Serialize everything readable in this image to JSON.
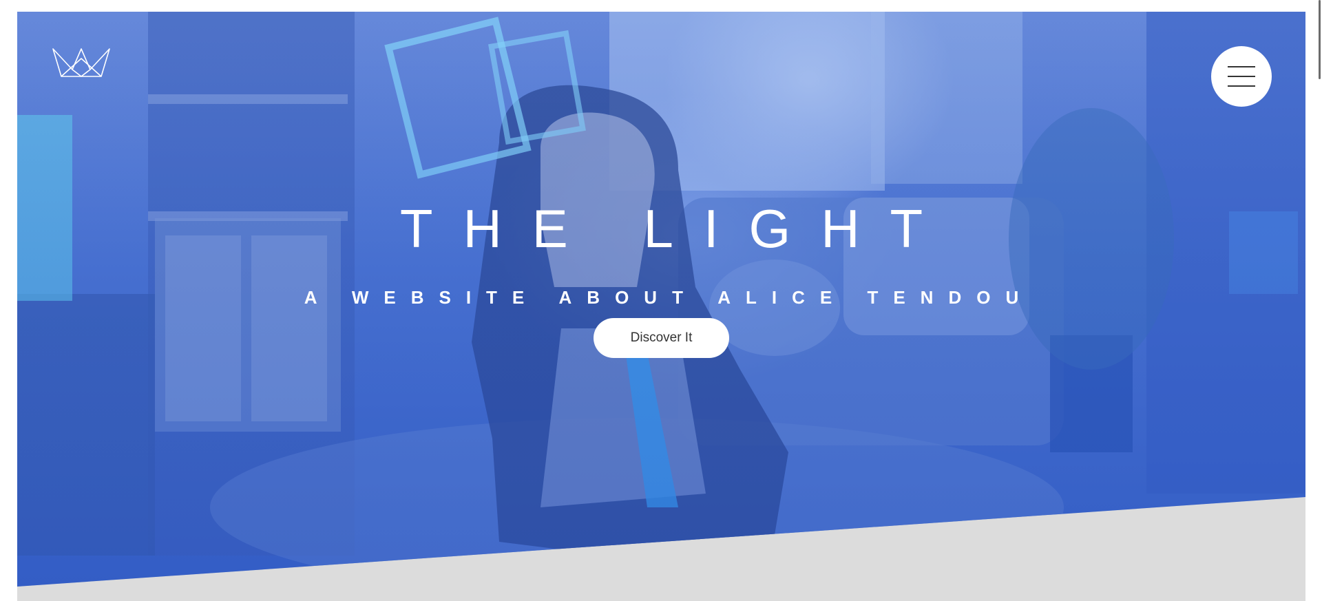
{
  "hero": {
    "title": "THE LIGHT",
    "subtitle": "A WEBSITE ABOUT ALICE TENDOU",
    "cta_label": "Discover It"
  },
  "header": {
    "logo_icon": "crown-icon",
    "menu_icon": "hamburger-menu-icon"
  },
  "colors": {
    "hero_tint": "#4f78d3",
    "section_background": "#dcdcdc",
    "button_background": "#ffffff",
    "text_on_hero": "#ffffff"
  }
}
